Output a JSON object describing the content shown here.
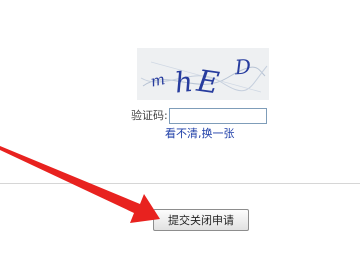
{
  "captcha": {
    "image_text": "mhED",
    "label": "验证码:",
    "input_value": "",
    "refresh_link": "看不清,换一张"
  },
  "form": {
    "submit_label": "提交关闭申请"
  },
  "annotation": {
    "arrow_color": "#e8221f"
  }
}
